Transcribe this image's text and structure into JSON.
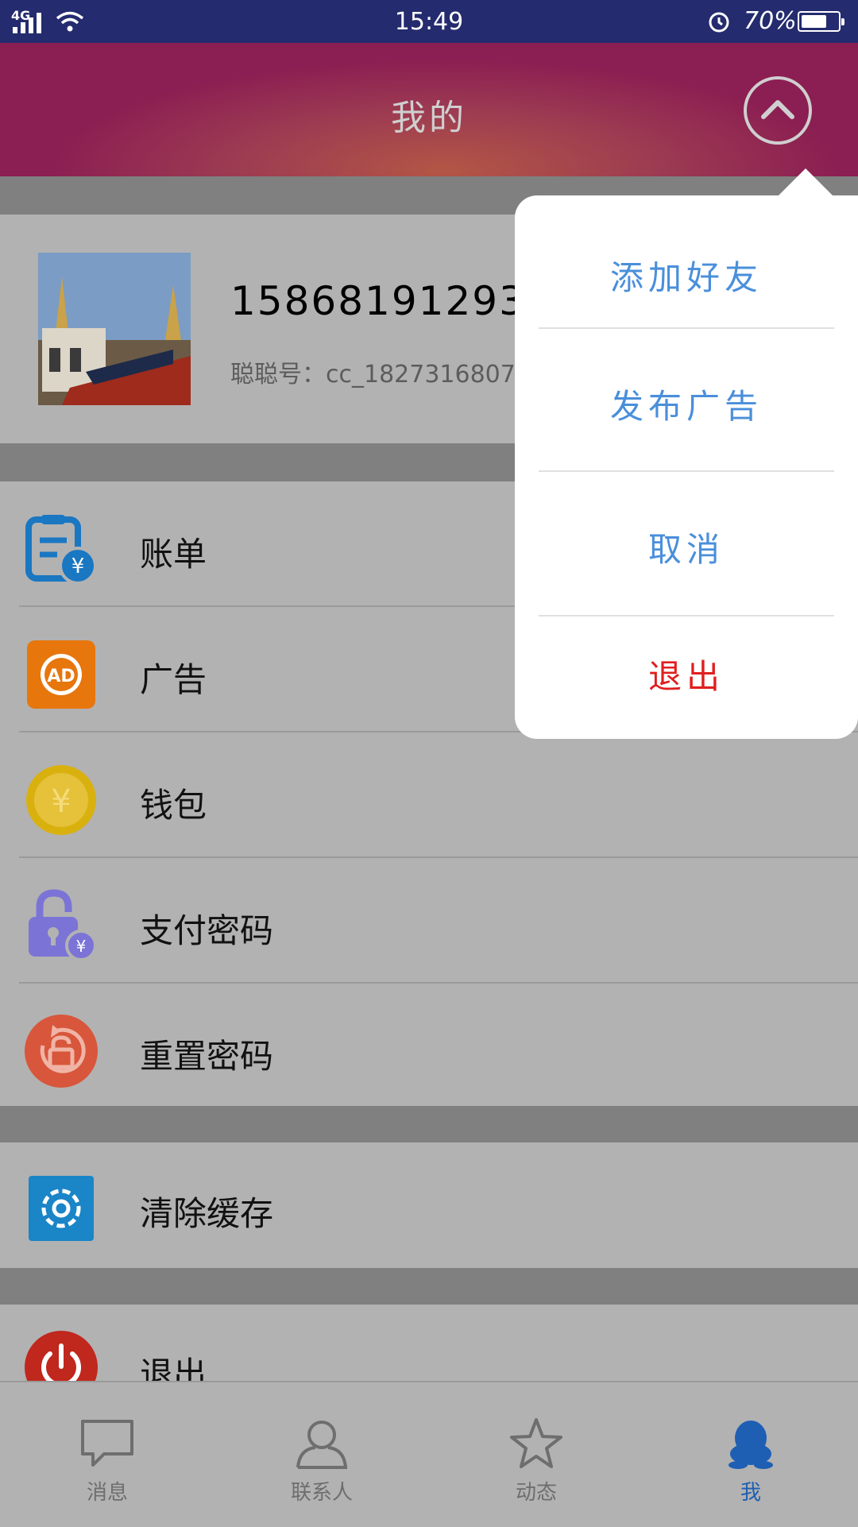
{
  "status_bar": {
    "network": "4G",
    "time": "15:49",
    "battery_percent": "70%",
    "battery_level": 0.7
  },
  "header": {
    "title": "我的",
    "toggle_icon": "chevron-up-icon"
  },
  "profile": {
    "phone": "15868191293",
    "account_id": "聪聪号：cc_1827316807"
  },
  "menu_items": [
    {
      "label": "账单",
      "icon": "bill-icon",
      "color": "#1a77c2"
    },
    {
      "label": "广告",
      "icon": "ad-icon",
      "color": "#e7760c"
    },
    {
      "label": "钱包",
      "icon": "wallet-coin-icon",
      "color": "#d9b10f"
    },
    {
      "label": "支付密码",
      "icon": "pay-lock-icon",
      "color": "#7b74d6"
    },
    {
      "label": "重置密码",
      "icon": "reset-lock-icon",
      "color": "#d8563b"
    }
  ],
  "settings_items": [
    {
      "label": "清除缓存",
      "icon": "gear-icon",
      "color": "#1a85c7"
    }
  ],
  "logout_item": {
    "label": "退出",
    "icon": "power-icon",
    "color": "#c0271d"
  },
  "tab_bar": {
    "tabs": [
      {
        "label": "消息",
        "icon": "message-icon",
        "active": false
      },
      {
        "label": "联系人",
        "icon": "contact-icon",
        "active": false
      },
      {
        "label": "动态",
        "icon": "star-icon",
        "active": false
      },
      {
        "label": "我",
        "icon": "penguin-icon",
        "active": true
      }
    ],
    "active_color": "#1e5fb4"
  },
  "popup_menu": {
    "items": [
      {
        "label": "添加好友"
      },
      {
        "label": "发布广告"
      },
      {
        "label": "取消"
      },
      {
        "label": "退出",
        "danger": true
      }
    ],
    "item_color": "#4a8fdb",
    "danger_color": "#e01f1f"
  }
}
